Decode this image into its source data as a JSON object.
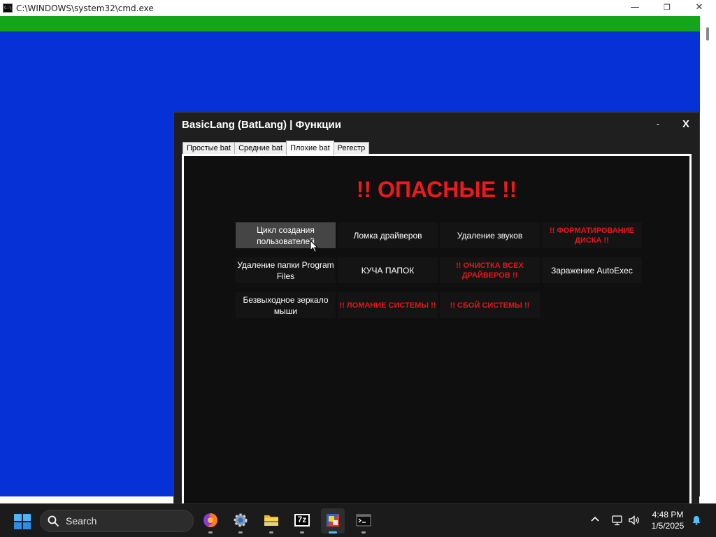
{
  "cmd": {
    "icon_text": "C:\\",
    "title": "C:\\WINDOWS\\system32\\cmd.exe",
    "minimize": "—",
    "maximize": "❐",
    "close": "✕",
    "colors": {
      "console_bg": "#0531d6",
      "green_bar": "#14a619"
    }
  },
  "app": {
    "title": "BasicLang (BatLang) | Функции",
    "minimize": "-",
    "close": "X",
    "tabs": [
      {
        "label": "Простые bat",
        "active": false
      },
      {
        "label": "Средние bat",
        "active": false
      },
      {
        "label": "Плохие bat",
        "active": true
      },
      {
        "label": "Регестр",
        "active": false
      }
    ],
    "heading": "!! ОПАСНЫЕ !!",
    "buttons": [
      {
        "label": "Цикл создания пользователей",
        "danger": false,
        "hover": true
      },
      {
        "label": "Ломка драйверов",
        "danger": false
      },
      {
        "label": "Удаление звуков",
        "danger": false
      },
      {
        "label": "!! ФОРМАТИРОВАНИЕ ДИСКА !!",
        "danger": true
      },
      {
        "label": "Удаление папки Program Files",
        "danger": false
      },
      {
        "label": "КУЧА ПАПОК",
        "danger": false
      },
      {
        "label": "!! ОЧИСТКА ВСЕХ ДРАЙВЕРОВ !!",
        "danger": true
      },
      {
        "label": "Заражение AutoExec",
        "danger": false
      },
      {
        "label": "Безвыходное зеркало мыши",
        "danger": false
      },
      {
        "label": "!! ЛОМАНИЕ СИСТЕМЫ !!",
        "danger": true
      },
      {
        "label": "!! СБОЙ СИСТЕМЫ !!",
        "danger": true
      }
    ],
    "colors": {
      "danger_text": "#ec1a1a",
      "window_bg": "#1f1f1f",
      "panel_bg": "#0f0f0f"
    }
  },
  "taskbar": {
    "search_label": "Search",
    "apps": [
      {
        "icon": "firefox-icon",
        "active": false
      },
      {
        "icon": "settings-icon",
        "active": false
      },
      {
        "icon": "file-explorer-icon",
        "active": false
      },
      {
        "icon": "7zip-icon",
        "icon_text": "7z",
        "active": false
      },
      {
        "icon": "batlang-app-icon",
        "active": true
      },
      {
        "icon": "terminal-icon",
        "active": false
      }
    ],
    "time": "4:48 PM",
    "date": "1/5/2025"
  }
}
